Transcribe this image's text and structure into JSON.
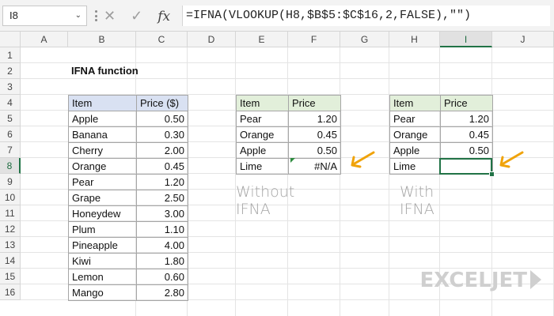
{
  "formula_bar": {
    "name_box": "I8",
    "cancel_icon": "✕",
    "enter_icon": "✓",
    "fx_label": "fx",
    "formula": "=IFNA(VLOOKUP(H8,$B$5:$C$16,2,FALSE),\"\")"
  },
  "columns": [
    "A",
    "B",
    "C",
    "D",
    "E",
    "F",
    "G",
    "H",
    "I",
    "J"
  ],
  "rows": [
    "1",
    "2",
    "3",
    "4",
    "5",
    "6",
    "7",
    "8",
    "9",
    "10",
    "11",
    "12",
    "13",
    "14",
    "15",
    "16"
  ],
  "selected_cell": "I8",
  "title": "IFNA function",
  "lookup_table": {
    "headers": [
      "Item",
      "Price ($)"
    ],
    "rows": [
      [
        "Apple",
        "0.50"
      ],
      [
        "Banana",
        "0.30"
      ],
      [
        "Cherry",
        "2.00"
      ],
      [
        "Orange",
        "0.45"
      ],
      [
        "Pear",
        "1.20"
      ],
      [
        "Grape",
        "2.50"
      ],
      [
        "Honeydew",
        "3.00"
      ],
      [
        "Plum",
        "1.10"
      ],
      [
        "Pineapple",
        "4.00"
      ],
      [
        "Kiwi",
        "1.80"
      ],
      [
        "Lemon",
        "0.60"
      ],
      [
        "Mango",
        "2.80"
      ]
    ]
  },
  "without_table": {
    "headers": [
      "Item",
      "Price"
    ],
    "rows": [
      [
        "Pear",
        "1.20"
      ],
      [
        "Orange",
        "0.45"
      ],
      [
        "Apple",
        "0.50"
      ],
      [
        "Lime",
        "#N/A"
      ]
    ],
    "caption": "Without IFNA"
  },
  "with_table": {
    "headers": [
      "Item",
      "Price"
    ],
    "rows": [
      [
        "Pear",
        "1.20"
      ],
      [
        "Orange",
        "0.45"
      ],
      [
        "Apple",
        "0.50"
      ],
      [
        "Lime",
        ""
      ]
    ],
    "caption": "With IFNA"
  },
  "colors": {
    "header_blue": "#d9e1f2",
    "header_green": "#e2efda",
    "arrow": "#f0a30a",
    "selection": "#217346"
  },
  "logo": "EXCELJET"
}
